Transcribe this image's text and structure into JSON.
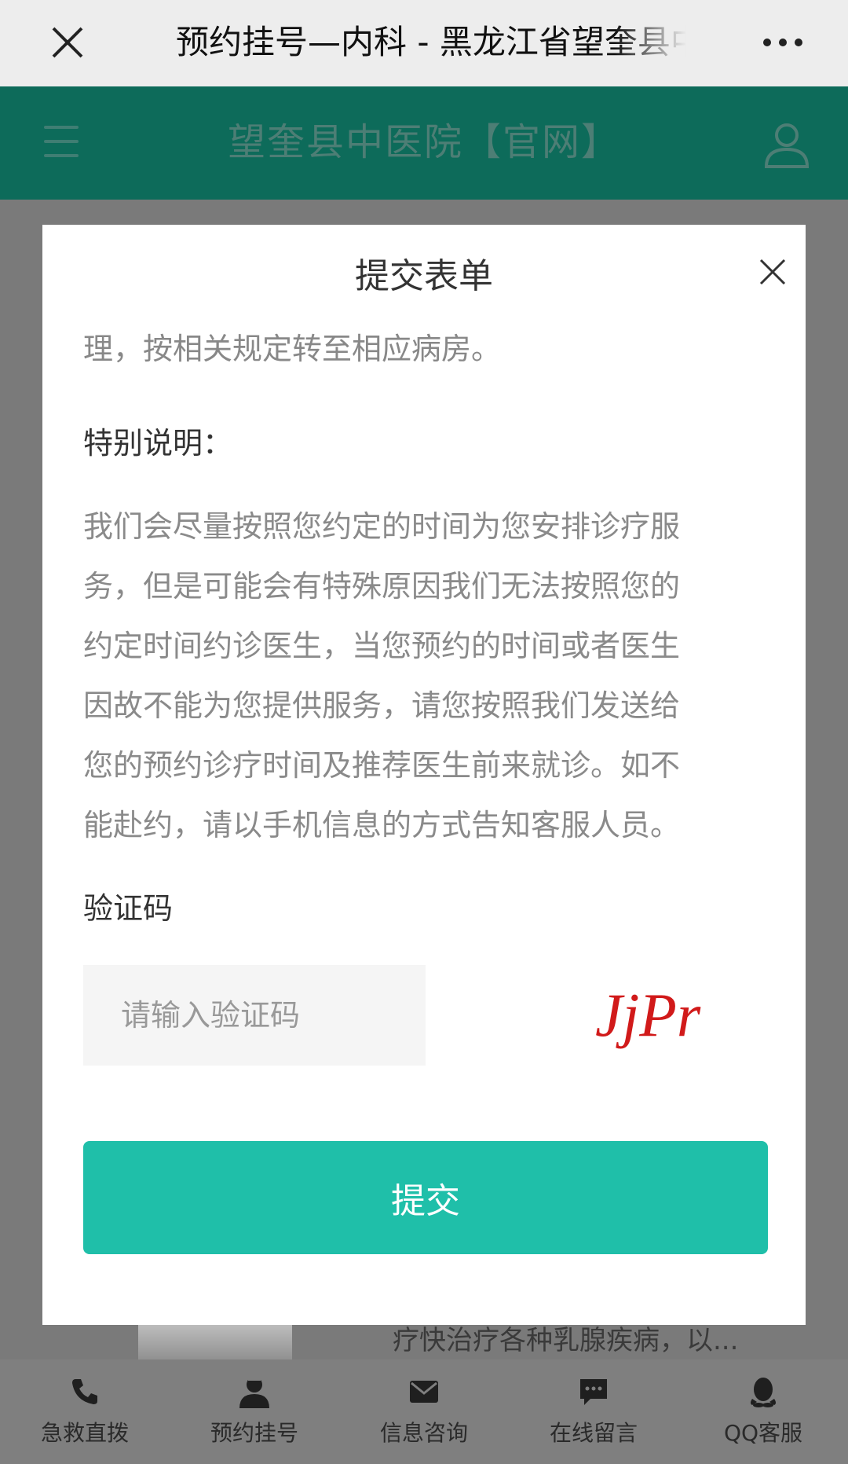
{
  "browser": {
    "title": "预约挂号—内科 - 黑龙江省望奎县中医院",
    "close_icon": "close-icon",
    "more_icon": "more-dots-icon"
  },
  "site": {
    "name": "望奎县中医院【官网】",
    "menu_icon": "hamburger-menu-icon",
    "user_icon": "user-icon",
    "header_color": "#0d6b5a"
  },
  "modal": {
    "title": "提交表单",
    "text_tail": "理，按相关规定转至相应病房。",
    "special_title": "特别说明：",
    "special_lines": [
      "我们会尽量按照您约定的时间为您安排诊疗服",
      "务，但是可能会有特殊原因我们无法按照您的",
      "约定时间约诊医生，当您预约的时间或者医生",
      "因故不能为您提供服务，请您按照我们发送给",
      "您的预约诊疗时间及推荐医生前来就诊。如不",
      "能赴约，请以手机信息的方式告知客服人员。"
    ],
    "captcha_label": "验证码",
    "captcha_placeholder": "请输入验证码",
    "captcha_value": "",
    "captcha_text": "JjPr",
    "submit_label": "提交",
    "submit_color": "#1fbfa9"
  },
  "behind": {
    "ghost_text": "疗快治疗各种乳腺疾病，以..."
  },
  "bottom_nav": [
    {
      "label": "急救直拨",
      "icon": "phone-icon"
    },
    {
      "label": "预约挂号",
      "icon": "doctor-icon"
    },
    {
      "label": "信息咨询",
      "icon": "mail-icon"
    },
    {
      "label": "在线留言",
      "icon": "chat-icon"
    },
    {
      "label": "QQ客服",
      "icon": "qq-icon"
    }
  ]
}
